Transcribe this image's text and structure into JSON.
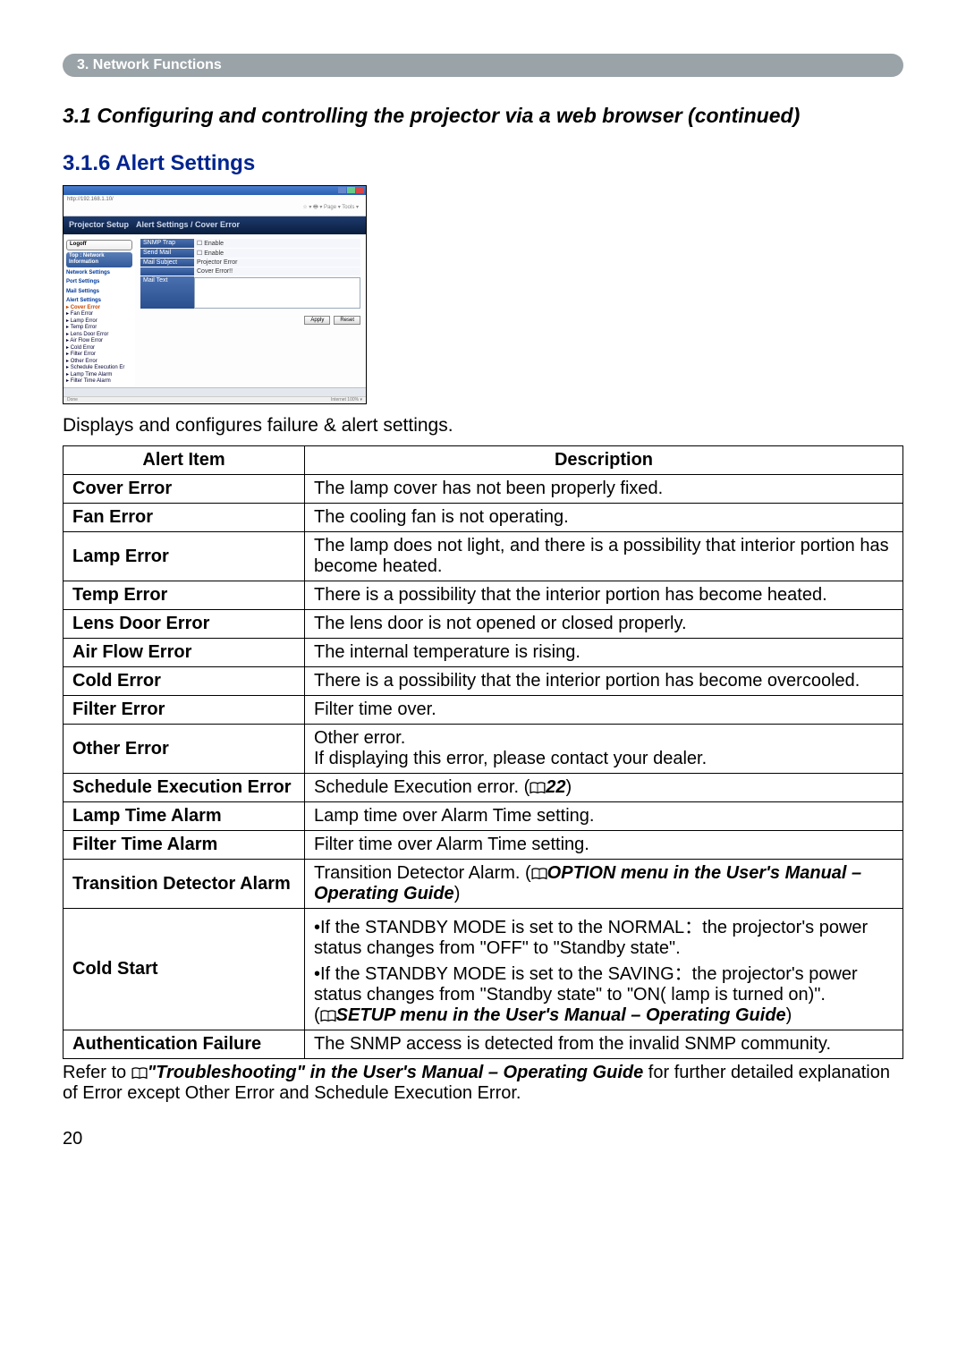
{
  "chapter_bar": "3. Network Functions",
  "section_title": "3.1 Configuring and controlling the projector via a web browser (continued)",
  "subsection_title": "3.1.6 Alert Settings",
  "screenshot": {
    "toolbar_line1": "http://192.168.1.10/",
    "toolbar_line2": "☆ ▾  🖶 ▾ Page ▾ Tools ▾",
    "banner_left": "Projector Setup",
    "panel_title": "Alert Settings / Cover Error",
    "side": {
      "tab_logoff": "Logoff",
      "tab_top": "Top : Network Information",
      "links": [
        "Network Settings",
        "Port Settings",
        "Mail Settings"
      ],
      "alert_hdr": "Alert Settings",
      "alert_current": "Cover Error",
      "alert_items": [
        "Fan Error",
        "Lamp Error",
        "Temp Error",
        "Lens Door Error",
        "Air Flow Error",
        "Cold Error",
        "Filter Error",
        "Other Error",
        "Schedule Execution Er",
        "Lamp Time Alarm",
        "Filter Time Alarm"
      ]
    },
    "rows": [
      {
        "l": "SNMP Trap",
        "r": "☐ Enable"
      },
      {
        "l": "Send Mail",
        "r": "☐ Enable"
      },
      {
        "l": "Mail Subject",
        "r": "Projector Error"
      },
      {
        "l": "",
        "r": "Cover Error!!"
      }
    ],
    "mail_text_label": "Mail Text",
    "btn_apply": "Apply",
    "btn_reset": "Reset",
    "status_left": "Done",
    "status_right": "Internet   100% ▾"
  },
  "intro": "Displays and configures failure & alert settings.",
  "table": {
    "header_item": "Alert Item",
    "header_desc": "Description",
    "rows": [
      {
        "item": "Cover Error",
        "desc": "The lamp cover has not been properly fixed."
      },
      {
        "item": "Fan Error",
        "desc": "The cooling fan is not operating."
      },
      {
        "item": "Lamp Error",
        "desc": "The lamp does not light, and there is a possibility that interior portion has become heated."
      },
      {
        "item": "Temp Error",
        "desc": "There is a possibility that the interior portion has become heated."
      },
      {
        "item": "Lens Door Error",
        "desc": "The lens door is not opened or closed properly."
      },
      {
        "item": "Air Flow Error",
        "desc": "The internal temperature is rising."
      },
      {
        "item": "Cold Error",
        "desc": "There is a possibility that the interior portion has become overcooled."
      },
      {
        "item": "Filter Error",
        "desc": "Filter time over."
      },
      {
        "item": "Other Error",
        "desc": "Other error.\nIf displaying this error, please contact your dealer."
      },
      {
        "item": "Schedule Execution Error",
        "desc_pre": "Schedule Execution error. (",
        "desc_ref": "22",
        "desc_post": ")"
      },
      {
        "item": "Lamp Time Alarm",
        "desc": "Lamp time over Alarm Time setting."
      },
      {
        "item": "Filter Time Alarm",
        "desc": "Filter time over Alarm Time setting."
      },
      {
        "item": "Transition Detector Alarm",
        "desc_pre": "Transition Detector Alarm. (",
        "desc_ref": "OPTION menu in the User's Manual – Operating Guide",
        "desc_post": ")"
      },
      {
        "item": "Cold Start",
        "desc_pre": "•If the STANDBY MODE is set to the NORMAL：the projector's power status changes from \"OFF\" to \"Standby state\".\n•If the STANDBY MODE is set to the SAVING：the projector's power status changes from \"Standby state\" to \"ON( lamp is turned on)\".\n(",
        "desc_ref": "SETUP menu in the User's Manual – Operating Guide",
        "desc_post": ")"
      },
      {
        "item": "Authentication Failure",
        "desc": "The SNMP access is detected from the invalid SNMP community."
      }
    ]
  },
  "footer_pre": "Refer to ",
  "footer_ref": "\"Troubleshooting\" in the User's Manual – Operating Guide",
  "footer_post": " for further detailed explanation of Error except Other Error and Schedule Execution Error.",
  "page_num": "20"
}
